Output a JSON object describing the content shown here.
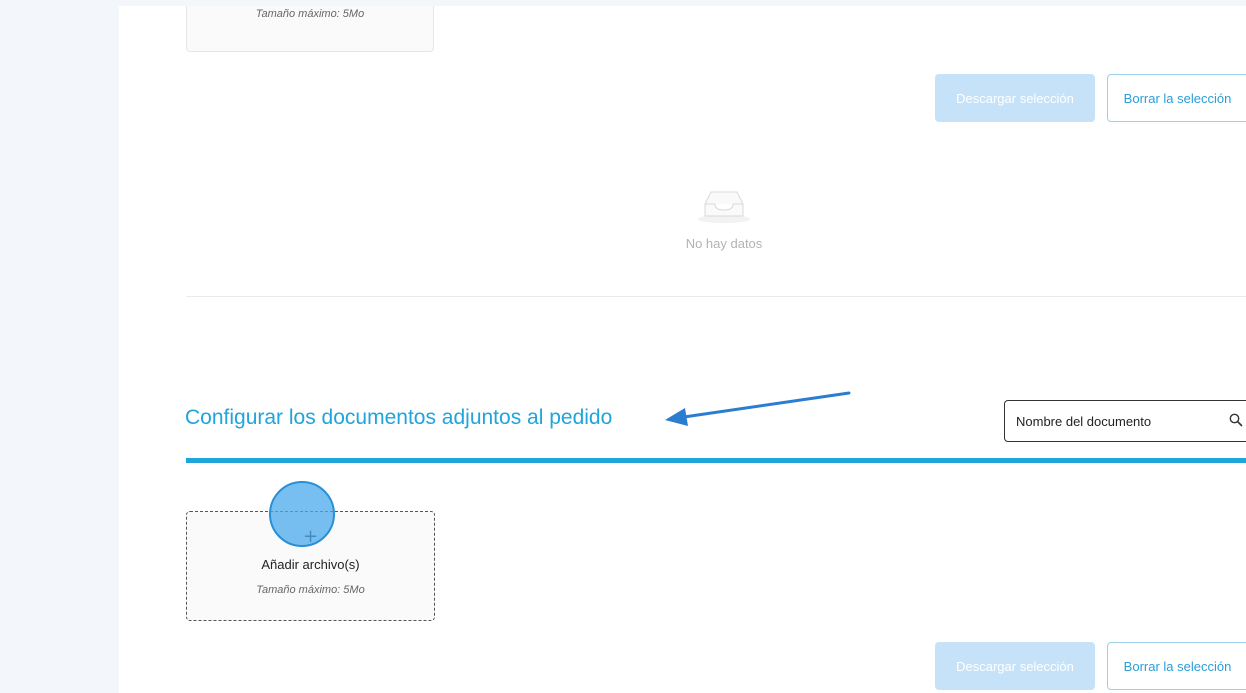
{
  "top_upload": {
    "max_size": "Tamaño máximo: 5Mo"
  },
  "top_actions": {
    "download_label": "Descargar selección",
    "clear_label": "Borrar la selección"
  },
  "empty_state": {
    "text": "No hay datos",
    "icon": "inbox-icon"
  },
  "section": {
    "title": "Configurar los documentos adjuntos al pedido",
    "annotation_icon": "arrow-annotation-icon"
  },
  "search": {
    "placeholder": "Nombre del documento",
    "icon": "search-icon"
  },
  "upload": {
    "plus": "+",
    "label": "Añadir archivo(s)",
    "max_size": "Tamaño máximo: 5Mo"
  },
  "bottom_actions": {
    "download_label": "Descargar selección",
    "clear_label": "Borrar la selección"
  },
  "colors": {
    "accent": "#1fa5db",
    "disabled_primary": "#c6e2f8",
    "annotation_arrow": "#2a7dcf",
    "cursor_highlight": "#4aaaeb"
  }
}
